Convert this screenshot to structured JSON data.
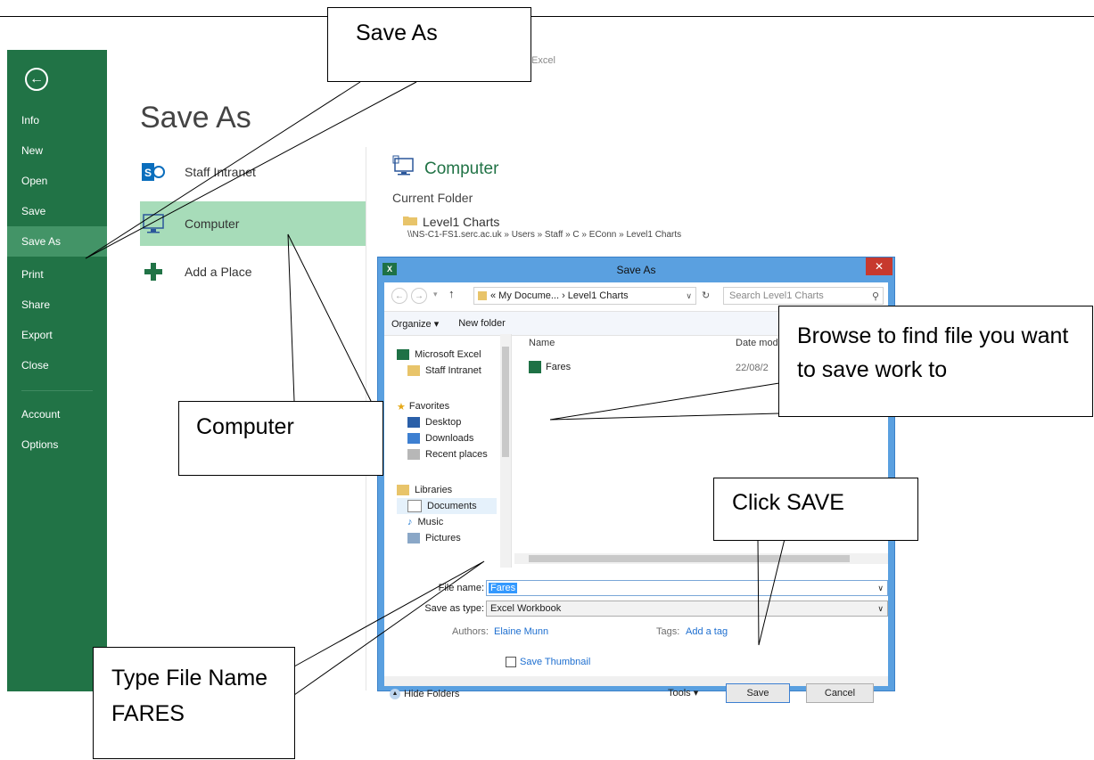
{
  "app": {
    "caption": "Excel"
  },
  "sidebar": {
    "items": [
      {
        "label": "Info"
      },
      {
        "label": "New"
      },
      {
        "label": "Open"
      },
      {
        "label": "Save"
      },
      {
        "label": "Save As",
        "active": true
      },
      {
        "label": "Print"
      },
      {
        "label": "Share"
      },
      {
        "label": "Export"
      },
      {
        "label": "Close"
      },
      {
        "label": "Account"
      },
      {
        "label": "Options"
      }
    ]
  },
  "page_title": "Save As",
  "places": [
    {
      "label": "Staff Intranet",
      "icon": "sharepoint-icon"
    },
    {
      "label": "Computer",
      "icon": "computer-icon",
      "active": true
    },
    {
      "label": "Add a Place",
      "icon": "plus-icon"
    }
  ],
  "computer": {
    "heading": "Computer",
    "current_folder_label": "Current Folder",
    "folder_name": "Level1 Charts",
    "folder_path": "\\\\NS-C1-FS1.serc.ac.uk » Users » Staff » C » EConn » Level1 Charts"
  },
  "dialog": {
    "title": "Save As",
    "address": "« My Docume... › Level1 Charts",
    "search_placeholder": "Search Level1 Charts",
    "organize": "Organize ▾",
    "new_folder": "New folder",
    "nav": [
      {
        "label": "Microsoft Excel"
      },
      {
        "label": "Staff Intranet"
      },
      {
        "label": "Favorites"
      },
      {
        "label": "Desktop"
      },
      {
        "label": "Downloads"
      },
      {
        "label": "Recent places"
      },
      {
        "label": "Libraries"
      },
      {
        "label": "Documents"
      },
      {
        "label": "Music"
      },
      {
        "label": "Pictures"
      }
    ],
    "columns": {
      "name": "Name",
      "date": "Date mod"
    },
    "files": [
      {
        "name": "Fares",
        "date": "22/08/2"
      }
    ],
    "file_name_label": "File name:",
    "file_name_value": "Fares",
    "save_type_label": "Save as type:",
    "save_type_value": "Excel Workbook",
    "authors_label": "Authors:",
    "authors_value": "Elaine Munn",
    "tags_label": "Tags:",
    "tags_value": "Add a tag",
    "thumbnail_label": "Save Thumbnail",
    "hide_folders": "Hide Folders",
    "tools": "Tools ▾",
    "save": "Save",
    "cancel": "Cancel"
  },
  "callouts": {
    "save_as": "Save As",
    "computer": "Computer",
    "browse": "Browse to find file you want to save work to",
    "click_save": "Click SAVE",
    "type_file": "Type File Name FARES"
  },
  "colors": {
    "excel_green": "#217346",
    "active_green": "#a7dcb9",
    "dialog_blue": "#5aa0e0"
  }
}
